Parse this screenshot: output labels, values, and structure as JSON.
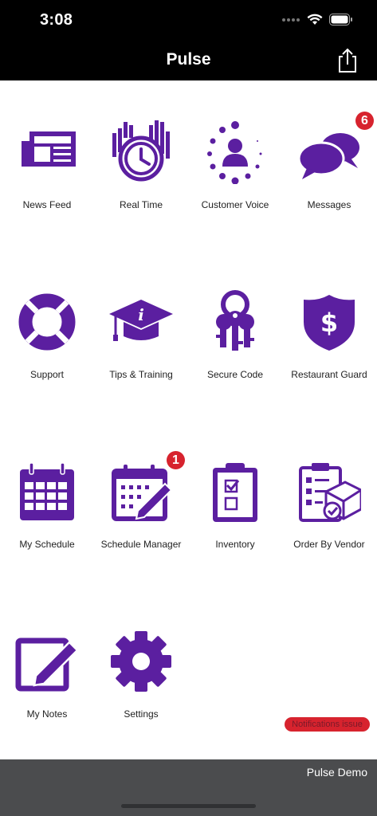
{
  "status_bar": {
    "time": "3:08"
  },
  "header": {
    "title": "Pulse",
    "share_icon": "share-icon"
  },
  "brand_color": "#5b1fa0",
  "badge_color": "#d7232e",
  "tiles": [
    {
      "label": "News Feed",
      "icon": "newspaper-icon"
    },
    {
      "label": "Real Time",
      "icon": "clock-chart-icon"
    },
    {
      "label": "Customer Voice",
      "icon": "customer-voice-icon"
    },
    {
      "label": "Messages",
      "icon": "chat-bubbles-icon",
      "badge": "6"
    },
    {
      "label": "Support",
      "icon": "lifebuoy-icon"
    },
    {
      "label": "Tips & Training",
      "icon": "graduation-cap-icon"
    },
    {
      "label": "Secure Code",
      "icon": "keys-icon"
    },
    {
      "label": "Restaurant Guard",
      "icon": "shield-dollar-icon"
    },
    {
      "label": "My Schedule",
      "icon": "calendar-icon"
    },
    {
      "label": "Schedule Manager",
      "icon": "calendar-edit-icon",
      "badge": "1"
    },
    {
      "label": "Inventory",
      "icon": "clipboard-checklist-icon"
    },
    {
      "label": "Order By Vendor",
      "icon": "vendor-order-icon"
    },
    {
      "label": "My Notes",
      "icon": "notes-edit-icon"
    },
    {
      "label": "Settings",
      "icon": "gear-icon"
    }
  ],
  "notifications_pill": "Notifications issue",
  "footer": {
    "label": "Pulse Demo"
  }
}
